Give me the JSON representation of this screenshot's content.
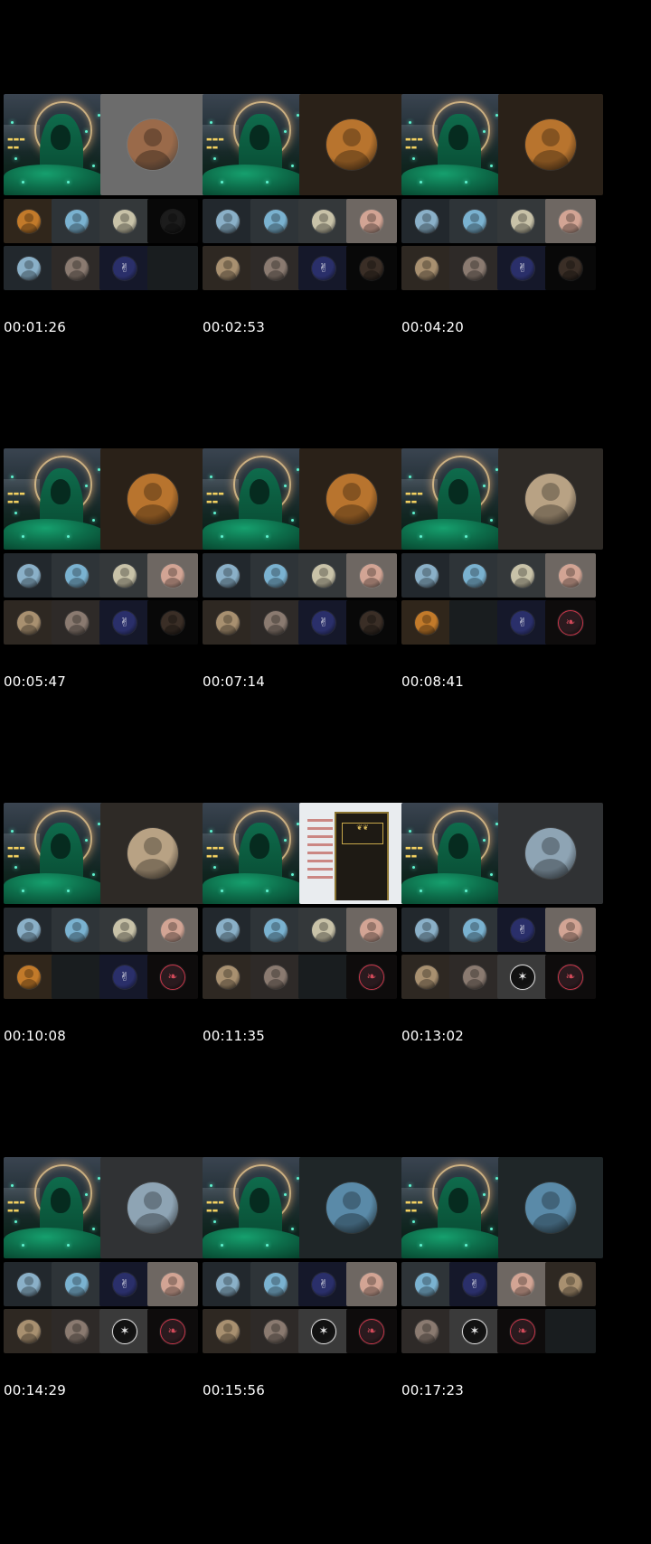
{
  "colors": {
    "background": "#000000",
    "timestamp_text": "#ffffff",
    "tile_dark": "#22282d",
    "tile_empty": "#191d1f"
  },
  "grid_title": "",
  "thumbnails": [
    {
      "timestamp": "00:01:26",
      "speaker": {
        "bg": "#6c6c6c",
        "avatar": "#9a6a4a",
        "icon": "person-avatar-icon"
      },
      "row1": [
        {
          "bg": "#30261b",
          "avatar": "#c27a2a",
          "icon": "avatar-icon"
        },
        {
          "bg": "#2e3438",
          "avatar": "#7ab2d0",
          "icon": "avatar-icon"
        },
        {
          "bg": "#34383a",
          "avatar": "#c8c2a8",
          "icon": "avatar-icon"
        },
        {
          "bg": "#080808",
          "avatar": "#1c1c1c",
          "icon": "avatar-icon"
        }
      ],
      "row2": [
        {
          "bg": "#22282d",
          "avatar": "#8ab0c8",
          "icon": "avatar-icon"
        },
        {
          "bg": "#2e2a28",
          "avatar": "#8a7a70",
          "icon": "avatar-icon"
        },
        {
          "bg": "#15182a",
          "avatar": "#2a2f6a",
          "icon": "emblem-icon"
        },
        {
          "bg": "#191d1f",
          "avatar": "",
          "icon": "empty-tile"
        }
      ]
    },
    {
      "timestamp": "00:02:53",
      "speaker": {
        "bg": "#2a2118",
        "avatar": "#b8742e",
        "icon": "person-avatar-icon"
      },
      "row1": [
        {
          "bg": "#22282d",
          "avatar": "#8ab0c8",
          "icon": "avatar-icon"
        },
        {
          "bg": "#2e3438",
          "avatar": "#7ab2d0",
          "icon": "avatar-icon"
        },
        {
          "bg": "#34383a",
          "avatar": "#c8c2a8",
          "icon": "avatar-icon"
        },
        {
          "bg": "#6e6762",
          "avatar": "#d2a494",
          "icon": "avatar-icon"
        }
      ],
      "row2": [
        {
          "bg": "#2e2822",
          "avatar": "#a89070",
          "icon": "avatar-icon"
        },
        {
          "bg": "#2e2a28",
          "avatar": "#8a7a70",
          "icon": "avatar-icon"
        },
        {
          "bg": "#15182a",
          "avatar": "#2a2f6a",
          "icon": "emblem-icon"
        },
        {
          "bg": "#080808",
          "avatar": "#3a2e26",
          "icon": "avatar-icon"
        }
      ]
    },
    {
      "timestamp": "00:04:20",
      "speaker": {
        "bg": "#2a2118",
        "avatar": "#b8742e",
        "icon": "person-avatar-icon"
      },
      "row1": [
        {
          "bg": "#22282d",
          "avatar": "#8ab0c8",
          "icon": "avatar-icon"
        },
        {
          "bg": "#2e3438",
          "avatar": "#7ab2d0",
          "icon": "avatar-icon"
        },
        {
          "bg": "#34383a",
          "avatar": "#c8c2a8",
          "icon": "avatar-icon"
        },
        {
          "bg": "#6e6762",
          "avatar": "#d2a494",
          "icon": "avatar-icon"
        }
      ],
      "row2": [
        {
          "bg": "#2e2822",
          "avatar": "#a89070",
          "icon": "avatar-icon"
        },
        {
          "bg": "#2e2a28",
          "avatar": "#8a7a70",
          "icon": "avatar-icon"
        },
        {
          "bg": "#15182a",
          "avatar": "#2a2f6a",
          "icon": "emblem-icon"
        },
        {
          "bg": "#080808",
          "avatar": "#3a2e26",
          "icon": "avatar-icon"
        }
      ]
    },
    {
      "timestamp": "00:05:47",
      "speaker": {
        "bg": "#2a2118",
        "avatar": "#b8742e",
        "icon": "person-avatar-icon"
      },
      "row1": [
        {
          "bg": "#22282d",
          "avatar": "#8ab0c8",
          "icon": "avatar-icon"
        },
        {
          "bg": "#2e3438",
          "avatar": "#7ab2d0",
          "icon": "avatar-icon"
        },
        {
          "bg": "#34383a",
          "avatar": "#c8c2a8",
          "icon": "avatar-icon"
        },
        {
          "bg": "#6e6762",
          "avatar": "#d2a494",
          "icon": "avatar-icon"
        }
      ],
      "row2": [
        {
          "bg": "#2e2822",
          "avatar": "#a89070",
          "icon": "avatar-icon"
        },
        {
          "bg": "#2e2a28",
          "avatar": "#8a7a70",
          "icon": "avatar-icon"
        },
        {
          "bg": "#15182a",
          "avatar": "#2a2f6a",
          "icon": "emblem-icon"
        },
        {
          "bg": "#080808",
          "avatar": "#3a2e26",
          "icon": "avatar-icon"
        }
      ]
    },
    {
      "timestamp": "00:07:14",
      "speaker": {
        "bg": "#2a2118",
        "avatar": "#b8742e",
        "icon": "person-avatar-icon"
      },
      "row1": [
        {
          "bg": "#22282d",
          "avatar": "#8ab0c8",
          "icon": "avatar-icon"
        },
        {
          "bg": "#2e3438",
          "avatar": "#7ab2d0",
          "icon": "avatar-icon"
        },
        {
          "bg": "#34383a",
          "avatar": "#c8c2a8",
          "icon": "avatar-icon"
        },
        {
          "bg": "#6e6762",
          "avatar": "#d2a494",
          "icon": "avatar-icon"
        }
      ],
      "row2": [
        {
          "bg": "#2e2822",
          "avatar": "#a89070",
          "icon": "avatar-icon"
        },
        {
          "bg": "#2e2a28",
          "avatar": "#8a7a70",
          "icon": "avatar-icon"
        },
        {
          "bg": "#15182a",
          "avatar": "#2a2f6a",
          "icon": "emblem-icon"
        },
        {
          "bg": "#080808",
          "avatar": "#3a2e26",
          "icon": "avatar-icon"
        }
      ]
    },
    {
      "timestamp": "00:08:41",
      "speaker": {
        "bg": "#2e2a26",
        "avatar": "#b8a284",
        "icon": "person-avatar-icon"
      },
      "row1": [
        {
          "bg": "#22282d",
          "avatar": "#8ab0c8",
          "icon": "avatar-icon"
        },
        {
          "bg": "#2e3438",
          "avatar": "#7ab2d0",
          "icon": "avatar-icon"
        },
        {
          "bg": "#34383a",
          "avatar": "#c8c2a8",
          "icon": "avatar-icon"
        },
        {
          "bg": "#6e6762",
          "avatar": "#d2a494",
          "icon": "avatar-icon"
        }
      ],
      "row2": [
        {
          "bg": "#30261b",
          "avatar": "#c27a2a",
          "icon": "avatar-icon"
        },
        {
          "bg": "#191d1f",
          "avatar": "",
          "icon": "empty-tile"
        },
        {
          "bg": "#15182a",
          "avatar": "#2a2f6a",
          "icon": "emblem-icon"
        },
        {
          "bg": "#0e0c0c",
          "avatar": "#2a1a1e",
          "icon": "ring-emblem-icon"
        }
      ]
    },
    {
      "timestamp": "00:10:08",
      "speaker": {
        "bg": "#2e2a26",
        "avatar": "#b8a284",
        "icon": "person-avatar-icon"
      },
      "row1": [
        {
          "bg": "#22282d",
          "avatar": "#8ab0c8",
          "icon": "avatar-icon"
        },
        {
          "bg": "#2e3438",
          "avatar": "#7ab2d0",
          "icon": "avatar-icon"
        },
        {
          "bg": "#34383a",
          "avatar": "#c8c2a8",
          "icon": "avatar-icon"
        },
        {
          "bg": "#6e6762",
          "avatar": "#d2a494",
          "icon": "avatar-icon"
        }
      ],
      "row2": [
        {
          "bg": "#30261b",
          "avatar": "#c27a2a",
          "icon": "avatar-icon"
        },
        {
          "bg": "#191d1f",
          "avatar": "",
          "icon": "empty-tile"
        },
        {
          "bg": "#15182a",
          "avatar": "#2a2f6a",
          "icon": "emblem-icon"
        },
        {
          "bg": "#0e0c0c",
          "avatar": "#2a1a1e",
          "icon": "ring-emblem-icon"
        }
      ]
    },
    {
      "timestamp": "00:11:35",
      "speaker": {
        "bg": "#e9ecef",
        "avatar": "",
        "icon": "shared-book-screen"
      },
      "row1": [
        {
          "bg": "#22282d",
          "avatar": "#8ab0c8",
          "icon": "avatar-icon"
        },
        {
          "bg": "#2e3438",
          "avatar": "#7ab2d0",
          "icon": "avatar-icon"
        },
        {
          "bg": "#34383a",
          "avatar": "#c8c2a8",
          "icon": "avatar-icon"
        },
        {
          "bg": "#6e6762",
          "avatar": "#d2a494",
          "icon": "avatar-icon"
        }
      ],
      "row2": [
        {
          "bg": "#2e2822",
          "avatar": "#a89070",
          "icon": "avatar-icon"
        },
        {
          "bg": "#2e2a28",
          "avatar": "#8a7a70",
          "icon": "avatar-icon"
        },
        {
          "bg": "#191d1f",
          "avatar": "",
          "icon": "empty-tile"
        },
        {
          "bg": "#0e0c0c",
          "avatar": "#2a1a1e",
          "icon": "ring-emblem-icon"
        }
      ]
    },
    {
      "timestamp": "00:13:02",
      "speaker": {
        "bg": "#303234",
        "avatar": "#8ea4b4",
        "icon": "person-avatar-icon"
      },
      "row1": [
        {
          "bg": "#22282d",
          "avatar": "#8ab0c8",
          "icon": "avatar-icon"
        },
        {
          "bg": "#2e3438",
          "avatar": "#7ab2d0",
          "icon": "avatar-icon"
        },
        {
          "bg": "#15182a",
          "avatar": "#2a2f6a",
          "icon": "emblem-icon"
        },
        {
          "bg": "#6e6762",
          "avatar": "#d2a494",
          "icon": "avatar-icon"
        }
      ],
      "row2": [
        {
          "bg": "#2e2822",
          "avatar": "#a89070",
          "icon": "avatar-icon"
        },
        {
          "bg": "#2e2a28",
          "avatar": "#8a7a70",
          "icon": "avatar-icon"
        },
        {
          "bg": "#3a3a3a",
          "avatar": "#111111",
          "icon": "seal-emblem-icon"
        },
        {
          "bg": "#0e0c0c",
          "avatar": "#2a1a1e",
          "icon": "ring-emblem-icon"
        }
      ]
    },
    {
      "timestamp": "00:14:29",
      "speaker": {
        "bg": "#303234",
        "avatar": "#8ea4b4",
        "icon": "person-avatar-icon"
      },
      "row1": [
        {
          "bg": "#22282d",
          "avatar": "#8ab0c8",
          "icon": "avatar-icon"
        },
        {
          "bg": "#2e3438",
          "avatar": "#7ab2d0",
          "icon": "avatar-icon"
        },
        {
          "bg": "#15182a",
          "avatar": "#2a2f6a",
          "icon": "emblem-icon"
        },
        {
          "bg": "#6e6762",
          "avatar": "#d2a494",
          "icon": "avatar-icon"
        }
      ],
      "row2": [
        {
          "bg": "#2e2822",
          "avatar": "#a89070",
          "icon": "avatar-icon"
        },
        {
          "bg": "#2e2a28",
          "avatar": "#8a7a70",
          "icon": "avatar-icon"
        },
        {
          "bg": "#3a3a3a",
          "avatar": "#111111",
          "icon": "seal-emblem-icon"
        },
        {
          "bg": "#0e0c0c",
          "avatar": "#2a1a1e",
          "icon": "ring-emblem-icon"
        }
      ]
    },
    {
      "timestamp": "00:15:56",
      "speaker": {
        "bg": "#1f2628",
        "avatar": "#5a8aa8",
        "icon": "person-avatar-icon"
      },
      "row1": [
        {
          "bg": "#22282d",
          "avatar": "#8ab0c8",
          "icon": "avatar-icon"
        },
        {
          "bg": "#2e3438",
          "avatar": "#7ab2d0",
          "icon": "avatar-icon"
        },
        {
          "bg": "#15182a",
          "avatar": "#2a2f6a",
          "icon": "emblem-icon"
        },
        {
          "bg": "#6e6762",
          "avatar": "#d2a494",
          "icon": "avatar-icon"
        }
      ],
      "row2": [
        {
          "bg": "#2e2822",
          "avatar": "#a89070",
          "icon": "avatar-icon"
        },
        {
          "bg": "#2e2a28",
          "avatar": "#8a7a70",
          "icon": "avatar-icon"
        },
        {
          "bg": "#3a3a3a",
          "avatar": "#111111",
          "icon": "seal-emblem-icon"
        },
        {
          "bg": "#0e0c0c",
          "avatar": "#2a1a1e",
          "icon": "ring-emblem-icon"
        }
      ]
    },
    {
      "timestamp": "00:17:23",
      "speaker": {
        "bg": "#1f2628",
        "avatar": "#5a8aa8",
        "icon": "person-avatar-icon"
      },
      "row1": [
        {
          "bg": "#2e3438",
          "avatar": "#7ab2d0",
          "icon": "avatar-icon"
        },
        {
          "bg": "#15182a",
          "avatar": "#2a2f6a",
          "icon": "emblem-icon"
        },
        {
          "bg": "#6e6762",
          "avatar": "#d2a494",
          "icon": "avatar-icon"
        },
        {
          "bg": "#2e2822",
          "avatar": "#a89070",
          "icon": "avatar-icon"
        }
      ],
      "row2": [
        {
          "bg": "#2e2a28",
          "avatar": "#8a7a70",
          "icon": "avatar-icon"
        },
        {
          "bg": "#3a3a3a",
          "avatar": "#111111",
          "icon": "seal-emblem-icon"
        },
        {
          "bg": "#0e0c0c",
          "avatar": "#2a1a1e",
          "icon": "ring-emblem-icon"
        },
        {
          "bg": "#191d1f",
          "avatar": "",
          "icon": "empty-tile"
        }
      ]
    }
  ]
}
